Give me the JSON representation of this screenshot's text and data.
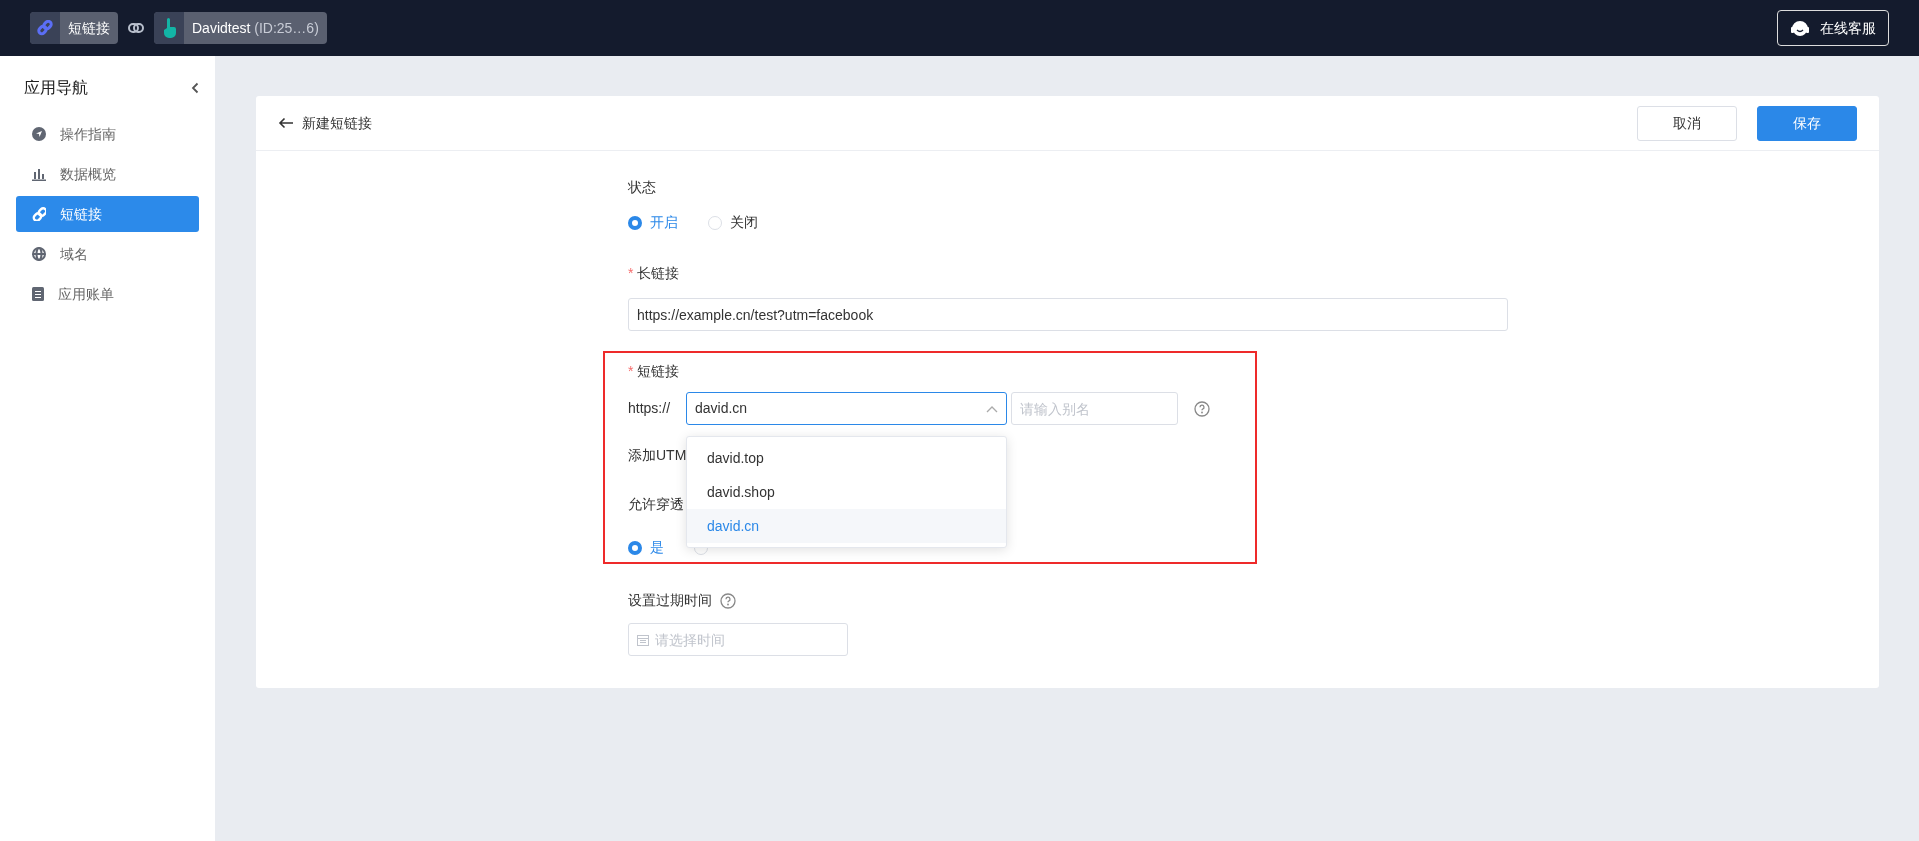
{
  "topbar": {
    "app": {
      "label": "短链接"
    },
    "account": {
      "label": "Davidtest",
      "id": "(ID:25…6)"
    },
    "support_button": {
      "label": "在线客服"
    }
  },
  "sidebar": {
    "title": "应用导航",
    "items": [
      {
        "label": "操作指南",
        "selected": false
      },
      {
        "label": "数据概览",
        "selected": false
      },
      {
        "label": "短链接",
        "selected": true
      },
      {
        "label": "域名",
        "selected": false
      },
      {
        "label": "应用账单",
        "selected": false
      }
    ]
  },
  "page": {
    "title": "新建短链接",
    "buttons": [
      {
        "label": "取消",
        "kind": "secondary"
      },
      {
        "label": "保存",
        "kind": "primary"
      }
    ]
  },
  "form": {
    "status": {
      "label": "状态",
      "options": [
        {
          "label": "开启",
          "selected": true
        },
        {
          "label": "关闭",
          "selected": false
        }
      ]
    },
    "long_url": {
      "label": "长链接",
      "required_mark": "*",
      "value": "https://example.cn/test?utm=facebook"
    },
    "short_url": {
      "label": "短链接",
      "required_mark": "*",
      "prefix": "https://",
      "domain": {
        "value": "david.cn",
        "expanded": true,
        "options": [
          {
            "label": "david.top",
            "selected": false
          },
          {
            "label": "david.shop",
            "selected": false
          },
          {
            "label": "david.cn",
            "selected": true
          }
        ]
      },
      "alias": {
        "placeholder": "请输入别名"
      }
    },
    "utm": {
      "label": "添加UTM"
    },
    "passthrough": {
      "label": "允许穿透",
      "options": [
        {
          "label": "是",
          "selected": true
        },
        {
          "selected": false
        }
      ]
    },
    "expiry": {
      "label": "设置过期时间",
      "date": {
        "placeholder": "请选择时间"
      }
    }
  }
}
